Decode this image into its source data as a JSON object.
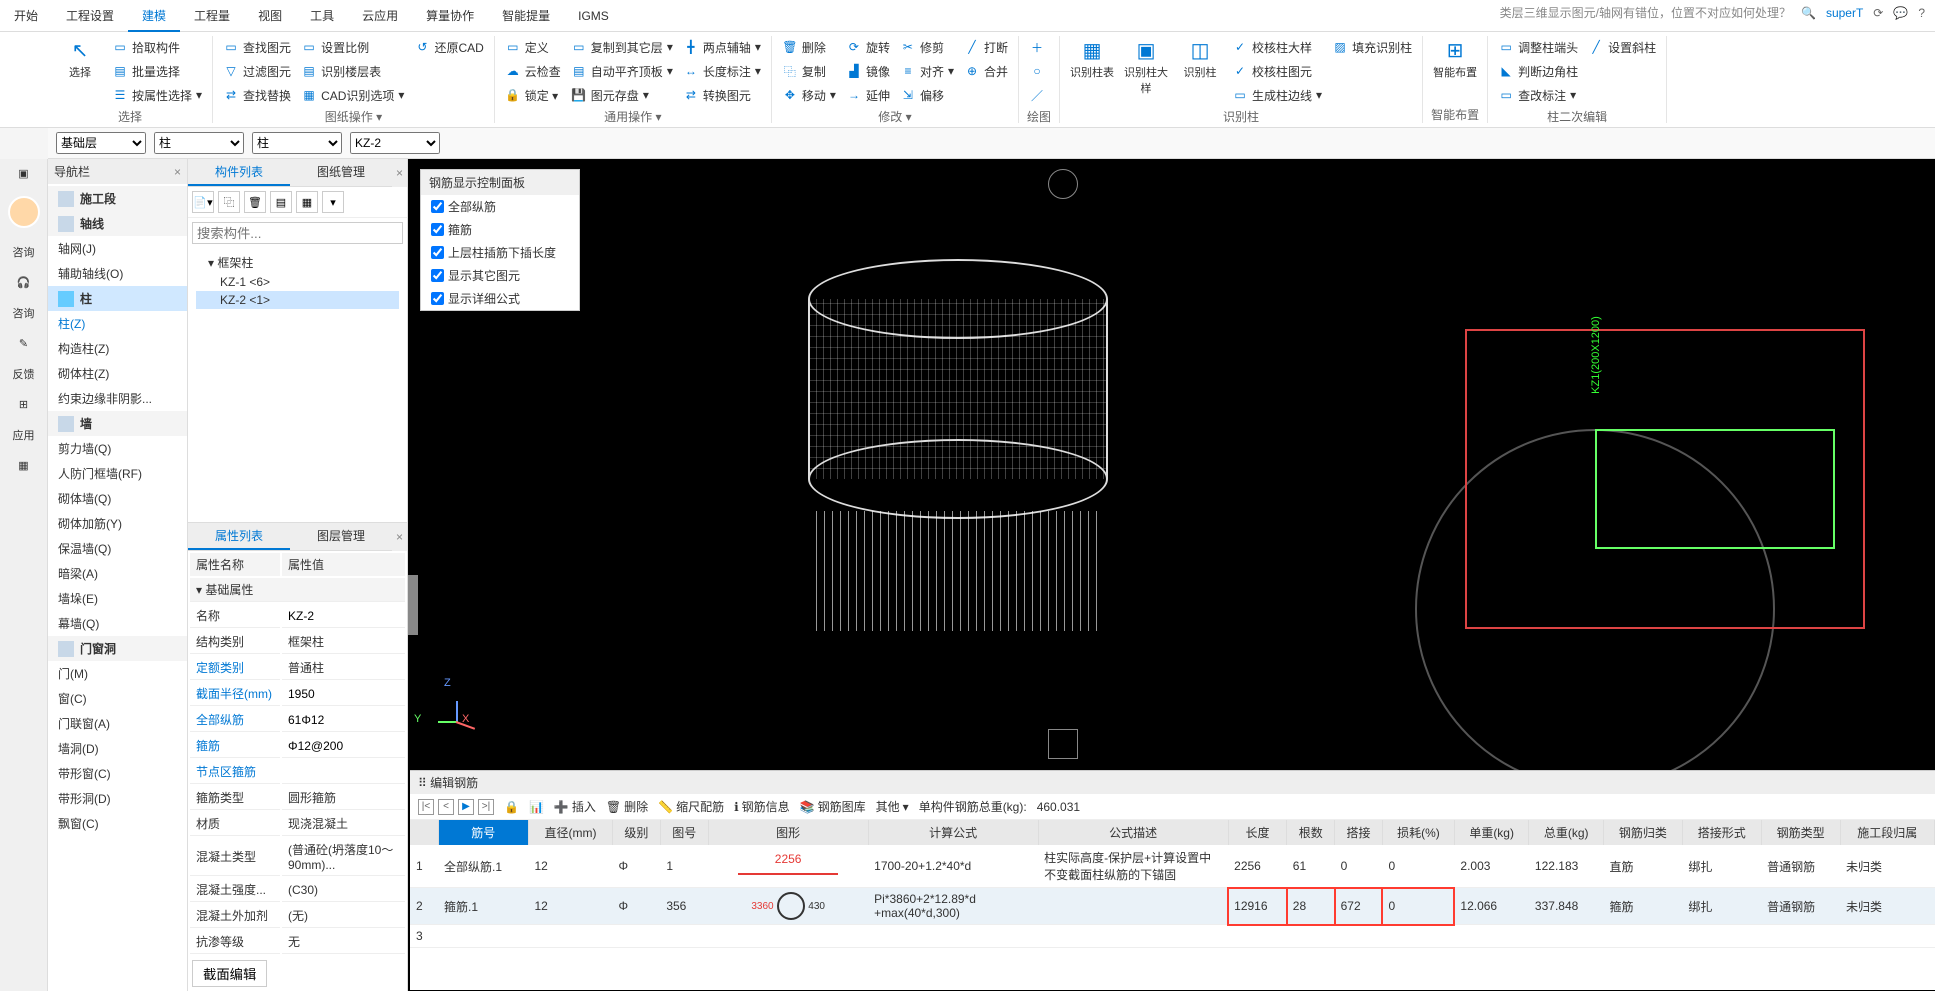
{
  "top_hint": "类层三维显示图元/轴网有错位，位置不对应如何处理？",
  "user": "superT",
  "tabs": [
    "开始",
    "工程设置",
    "建模",
    "工程量",
    "视图",
    "工具",
    "云应用",
    "算量协作",
    "智能提量",
    "IGMS"
  ],
  "active_tab": 2,
  "ribbon": {
    "g1": {
      "label": "选择",
      "big": "选择",
      "items": [
        "拾取构件",
        "批量选择",
        "按属性选择"
      ]
    },
    "g2": {
      "items1": [
        "查找图元",
        "过滤图元",
        "查找替换"
      ],
      "items2": [
        "设置比例",
        "识别楼层表",
        "CAD识别选项"
      ],
      "items3": [
        "还原CAD"
      ],
      "label": "图纸操作"
    },
    "g3": {
      "items": [
        "定义",
        "云检查",
        "自动平齐顶板",
        "图元存盘"
      ],
      "items2": [
        "复制到其它层",
        "两点辅轴",
        "转换图元"
      ],
      "label": "通用操作"
    },
    "g4": {
      "items": [
        "长度标注"
      ]
    },
    "g5": {
      "items1": [
        "删除",
        "复制",
        "移动"
      ],
      "items2": [
        "旋转",
        "镜像",
        "延伸"
      ],
      "items3": [
        "修剪",
        "对齐",
        "偏移"
      ],
      "items4": [
        "打断",
        "合并"
      ],
      "label": "修改"
    },
    "g6": {
      "label": "绘图"
    },
    "g7": {
      "big": [
        "识别柱表",
        "识别柱大样",
        "识别柱"
      ],
      "items": [
        "校核柱大样",
        "校核柱图元",
        "生成柱边线",
        "填充识别柱"
      ],
      "label": "识别柱"
    },
    "g8": {
      "big": "智能布置",
      "label": "智能布置"
    },
    "g9": {
      "items": [
        "调整柱端头",
        "判断边角柱",
        "查改标注",
        "设置斜柱"
      ],
      "label": "柱二次编辑"
    }
  },
  "dropdowns": [
    "基础层",
    "柱",
    "柱",
    "KZ-2"
  ],
  "nav": {
    "title": "导航栏",
    "sections": [
      {
        "label": "施工段",
        "icon": "stage"
      },
      {
        "label": "轴线",
        "icon": "grid"
      }
    ],
    "items1": [
      "轴网(J)",
      "辅助轴线(O)"
    ],
    "col_section": "柱",
    "col_items": [
      "柱(Z)",
      "构造柱(Z)",
      "砌体柱(Z)",
      "约束边缘非阴影..."
    ],
    "wall_section": "墙",
    "wall_items": [
      "剪力墙(Q)",
      "人防门框墙(RF)",
      "砌体墙(Q)",
      "砌体加筋(Y)",
      "保温墙(Q)",
      "暗梁(A)",
      "墙垛(E)",
      "幕墙(Q)"
    ],
    "door_section": "门窗洞",
    "door_items": [
      "门(M)",
      "窗(C)",
      "门联窗(A)",
      "墙洞(D)",
      "带形窗(C)",
      "带形洞(D)",
      "飘窗(C)"
    ]
  },
  "list_panel": {
    "tabs": [
      "构件列表",
      "图纸管理"
    ],
    "search_ph": "搜索构件...",
    "tree_root": "框架柱",
    "tree_items": [
      "KZ-1 <6>",
      "KZ-2 <1>"
    ],
    "selected": 1
  },
  "props": {
    "tabs": [
      "属性列表",
      "图层管理"
    ],
    "head": [
      "属性名称",
      "属性值"
    ],
    "section": "基础属性",
    "rows": [
      {
        "k": "名称",
        "v": "KZ-2",
        "blue": false
      },
      {
        "k": "结构类别",
        "v": "框架柱",
        "blue": false
      },
      {
        "k": "定额类别",
        "v": "普通柱",
        "blue": true
      },
      {
        "k": "截面半径(mm)",
        "v": "1950",
        "blue": true
      },
      {
        "k": "全部纵筋",
        "v": "61Φ12",
        "blue": true
      },
      {
        "k": "箍筋",
        "v": "Φ12@200",
        "blue": true
      },
      {
        "k": "节点区箍筋",
        "v": "",
        "blue": true
      },
      {
        "k": "箍筋类型",
        "v": "圆形箍筋",
        "blue": false
      },
      {
        "k": "材质",
        "v": "现浇混凝土",
        "blue": false
      },
      {
        "k": "混凝土类型",
        "v": "(普通砼(坍落度10～90mm)...",
        "blue": false
      },
      {
        "k": "混凝土强度...",
        "v": "(C30)",
        "blue": false
      },
      {
        "k": "混凝土外加剂",
        "v": "(无)",
        "blue": false
      },
      {
        "k": "抗渗等级",
        "v": "无",
        "blue": false
      }
    ],
    "section_btn": "截面编辑"
  },
  "overlay": {
    "title": "钢筋显示控制面板",
    "checks": [
      "全部纵筋",
      "箍筋",
      "上层柱插筋下插长度",
      "显示其它图元",
      "显示详细公式"
    ]
  },
  "viewport": {
    "plan_text": "KZ1(200X1200)"
  },
  "rebar": {
    "title": "编辑钢筋",
    "toolbar": [
      "插入",
      "删除",
      "缩尺配筋",
      "钢筋信息",
      "钢筋图库",
      "其他"
    ],
    "total_label": "单构件钢筋总重(kg):",
    "total": "460.031",
    "cols": [
      "筋号",
      "直径(mm)",
      "级别",
      "图号",
      "图形",
      "计算公式",
      "公式描述",
      "长度",
      "根数",
      "搭接",
      "损耗(%)",
      "单重(kg)",
      "总重(kg)",
      "钢筋归类",
      "搭接形式",
      "钢筋类型",
      "施工段归属"
    ],
    "rows": [
      {
        "n": "1",
        "name": "全部纵筋.1",
        "d": "12",
        "grade": "Φ",
        "fig": "1",
        "shape_val": "2256",
        "formula": "1700-20+1.2*40*d",
        "desc": "柱实际高度-保护层+计算设置中不变截面柱纵筋的下锚固",
        "len": "2256",
        "cnt": "61",
        "lap": "0",
        "loss": "0",
        "uw": "2.003",
        "tw": "122.183",
        "cat": "直筋",
        "join": "绑扎",
        "type": "普通钢筋",
        "seg": "未归类"
      },
      {
        "n": "2",
        "name": "箍筋.1",
        "d": "12",
        "grade": "Φ",
        "fig": "356",
        "shape_l": "3360",
        "shape_r": "430",
        "formula": "Pi*3860+2*12.89*d +max(40*d,300)",
        "desc": "",
        "len": "12916",
        "cnt": "28",
        "lap": "672",
        "loss": "0",
        "uw": "12.066",
        "tw": "337.848",
        "cat": "箍筋",
        "join": "绑扎",
        "type": "普通钢筋",
        "seg": "未归类"
      },
      {
        "n": "3",
        "name": "",
        "d": "",
        "grade": "",
        "fig": "",
        "formula": "",
        "desc": "",
        "len": "",
        "cnt": "",
        "lap": "",
        "loss": "",
        "uw": "",
        "tw": "",
        "cat": "",
        "join": "",
        "type": "",
        "seg": ""
      }
    ],
    "chart_data": {
      "type": "table",
      "title": "编辑钢筋",
      "columns": [
        "筋号",
        "直径(mm)",
        "图号",
        "长度",
        "根数",
        "搭接",
        "损耗(%)",
        "单重(kg)",
        "总重(kg)"
      ],
      "rows": [
        [
          "全部纵筋.1",
          12,
          1,
          2256,
          61,
          0,
          0,
          2.003,
          122.183
        ],
        [
          "箍筋.1",
          12,
          356,
          12916,
          28,
          672,
          0,
          12.066,
          337.848
        ]
      ],
      "total_weight_kg": 460.031
    }
  },
  "left_strip": [
    "咨询",
    "咨询",
    "反馈",
    "应用"
  ]
}
